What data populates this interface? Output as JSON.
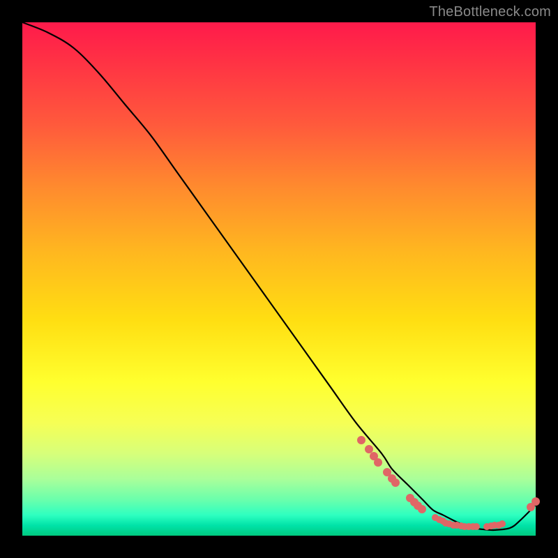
{
  "watermark": "TheBottleneck.com",
  "colors": {
    "dot": "#e06666",
    "curve": "#000000"
  },
  "chart_data": {
    "type": "line",
    "title": "",
    "xlabel": "",
    "ylabel": "",
    "xlim": [
      0,
      100
    ],
    "ylim": [
      0,
      100
    ],
    "grid": false,
    "curve": {
      "x": [
        0,
        5,
        10,
        15,
        20,
        25,
        30,
        35,
        40,
        45,
        50,
        55,
        60,
        65,
        70,
        72,
        75,
        78,
        80,
        82,
        85,
        88,
        90,
        92,
        95,
        97,
        100
      ],
      "y": [
        100,
        98,
        95,
        90,
        84,
        78,
        71,
        64,
        57,
        50,
        43,
        36,
        29,
        22,
        16,
        13,
        10,
        7,
        5,
        4,
        2.5,
        1.5,
        1.2,
        1.1,
        1.5,
        3.0,
        6.0
      ]
    },
    "points_cluster": [
      {
        "x": 66.0,
        "y": 18.6
      },
      {
        "x": 67.5,
        "y": 16.9
      },
      {
        "x": 68.5,
        "y": 15.5
      },
      {
        "x": 69.3,
        "y": 14.3
      },
      {
        "x": 71.0,
        "y": 12.3
      },
      {
        "x": 72.0,
        "y": 11.1
      },
      {
        "x": 72.7,
        "y": 10.3
      },
      {
        "x": 75.5,
        "y": 7.3
      },
      {
        "x": 76.3,
        "y": 6.5
      },
      {
        "x": 77.0,
        "y": 5.9
      },
      {
        "x": 77.8,
        "y": 5.2
      },
      {
        "x": 80.5,
        "y": 3.5
      },
      {
        "x": 81.2,
        "y": 3.1
      },
      {
        "x": 81.9,
        "y": 2.8
      },
      {
        "x": 82.5,
        "y": 2.5
      },
      {
        "x": 83.2,
        "y": 2.3
      },
      {
        "x": 84.0,
        "y": 2.1
      },
      {
        "x": 84.7,
        "y": 2.0
      },
      {
        "x": 85.4,
        "y": 1.9
      },
      {
        "x": 86.2,
        "y": 1.8
      },
      {
        "x": 87.0,
        "y": 1.8
      },
      {
        "x": 87.8,
        "y": 1.8
      },
      {
        "x": 88.5,
        "y": 1.8
      },
      {
        "x": 90.5,
        "y": 1.8
      },
      {
        "x": 91.3,
        "y": 1.9
      },
      {
        "x": 92.0,
        "y": 2.0
      },
      {
        "x": 92.8,
        "y": 2.1
      },
      {
        "x": 93.5,
        "y": 2.3
      },
      {
        "x": 99.0,
        "y": 5.6
      },
      {
        "x": 100.0,
        "y": 6.7
      }
    ]
  }
}
